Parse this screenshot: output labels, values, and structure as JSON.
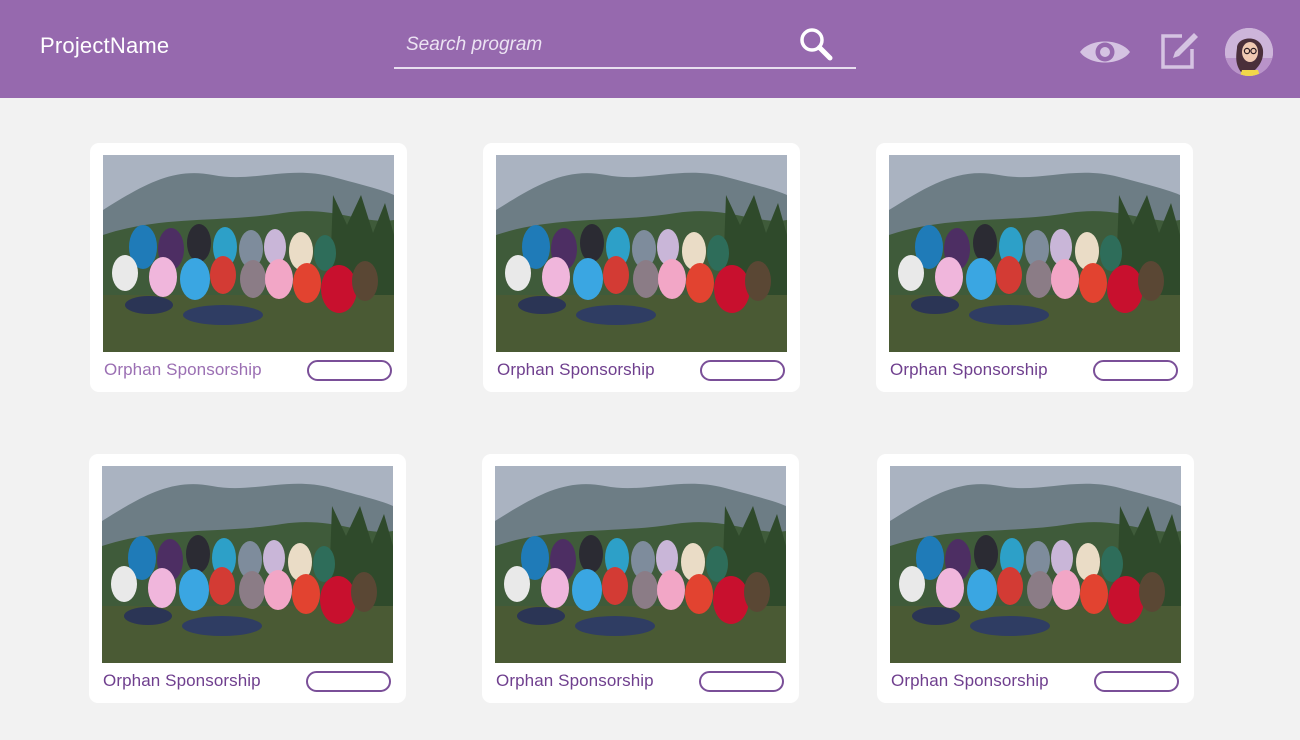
{
  "header": {
    "brand": "ProjectName",
    "search_placeholder": "Search program",
    "icons": [
      "search-icon",
      "eye-icon",
      "edit-icon",
      "avatar"
    ],
    "colors": {
      "bar": "#9669ae",
      "accent": "#6f3f8e"
    }
  },
  "cards": [
    {
      "title": "Orphan Sponsorship",
      "button_label": ""
    },
    {
      "title": "Orphan Sponsorship",
      "button_label": ""
    },
    {
      "title": "Orphan Sponsorship",
      "button_label": ""
    },
    {
      "title": "Orphan Sponsorship",
      "button_label": ""
    },
    {
      "title": "Orphan Sponsorship",
      "button_label": ""
    },
    {
      "title": "Orphan Sponsorship",
      "button_label": ""
    }
  ]
}
